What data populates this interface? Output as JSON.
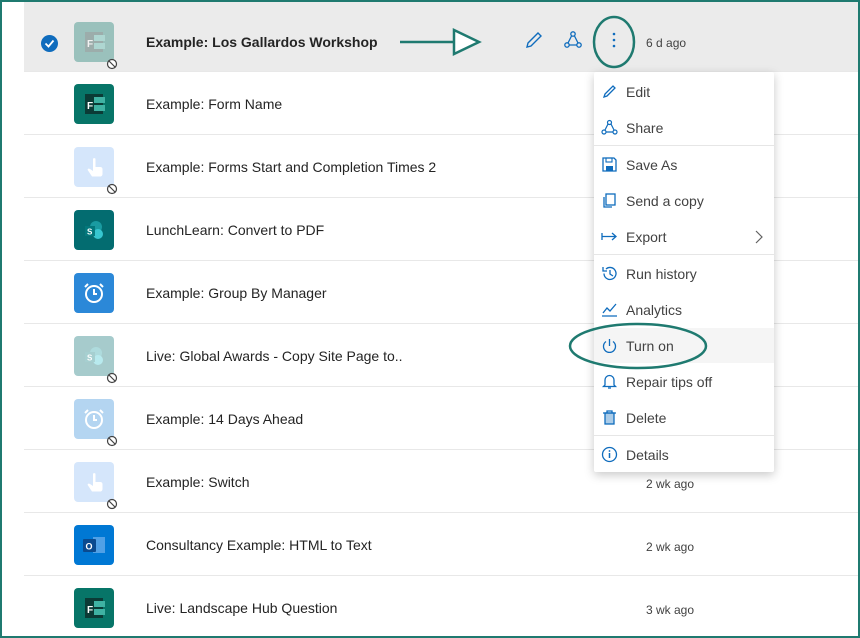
{
  "flows": [
    {
      "name": "Example: Los Gallardos Workshop",
      "modified": "6 d ago",
      "icon": "forms-icon",
      "off": true,
      "selected": true
    },
    {
      "name": "Example: Form Name",
      "modified": "",
      "icon": "forms-icon",
      "off": false,
      "selected": false
    },
    {
      "name": "Example: Forms Start and Completion Times 2",
      "modified": "",
      "icon": "touch-icon",
      "off": true,
      "selected": false
    },
    {
      "name": "LunchLearn: Convert to PDF",
      "modified": "",
      "icon": "sharepoint-icon",
      "off": false,
      "selected": false
    },
    {
      "name": "Example: Group By Manager",
      "modified": "",
      "icon": "alarm-clock-icon",
      "off": false,
      "selected": false
    },
    {
      "name": "Live: Global Awards - Copy Site Page to..",
      "modified": "",
      "icon": "sharepoint-icon",
      "off": true,
      "selected": false
    },
    {
      "name": "Example: 14 Days Ahead",
      "modified": "",
      "icon": "alarm-clock-icon",
      "off": true,
      "selected": false
    },
    {
      "name": "Example: Switch",
      "modified": "2 wk ago",
      "icon": "touch-icon",
      "off": true,
      "selected": false
    },
    {
      "name": "Consultancy Example: HTML to Text",
      "modified": "2 wk ago",
      "icon": "outlook-icon",
      "off": false,
      "selected": false
    },
    {
      "name": "Live: Landscape Hub Question",
      "modified": "3 wk ago",
      "icon": "forms-icon",
      "off": false,
      "selected": false
    }
  ],
  "menu": {
    "items": [
      {
        "label": "Edit",
        "icon": "pencil-icon"
      },
      {
        "label": "Share",
        "icon": "share-icon"
      },
      {
        "label": "Save As",
        "icon": "save-as-icon"
      },
      {
        "label": "Send a copy",
        "icon": "copy-icon"
      },
      {
        "label": "Export",
        "icon": "export-icon",
        "submenu": true
      },
      {
        "label": "Run history",
        "icon": "history-icon"
      },
      {
        "label": "Analytics",
        "icon": "analytics-icon"
      },
      {
        "label": "Turn on",
        "icon": "power-icon",
        "highlighted": true
      },
      {
        "label": "Repair tips off",
        "icon": "bell-icon"
      },
      {
        "label": "Delete",
        "icon": "delete-icon"
      },
      {
        "label": "Details",
        "icon": "info-icon"
      }
    ]
  },
  "colors": {
    "accent": "#0f6cbd",
    "annotation": "#1f7a70",
    "forms": "#077568",
    "touch": "#4f9cf9",
    "sharepoint": "#036c70",
    "clock": "#2b88d8",
    "outlook": "#0078d4"
  }
}
